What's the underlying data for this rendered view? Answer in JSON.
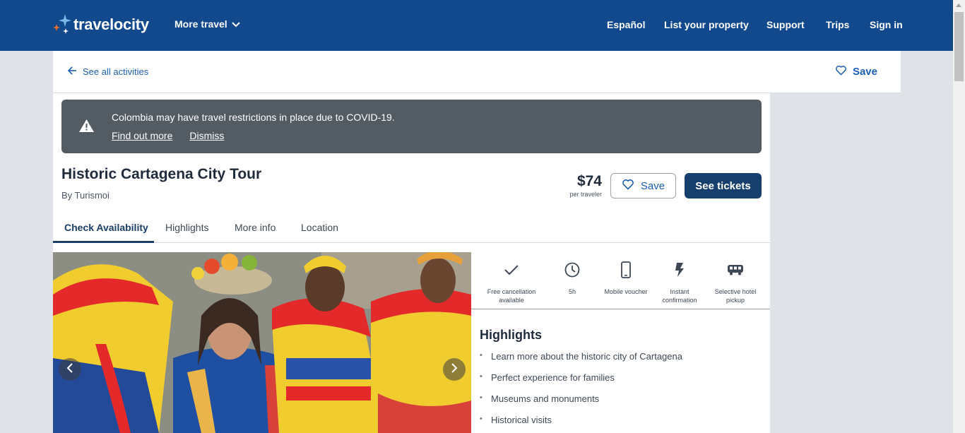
{
  "header": {
    "brand": "travelocity",
    "more_travel": "More travel",
    "nav": [
      "Español",
      "List your property",
      "Support",
      "Trips",
      "Sign in"
    ]
  },
  "subheader": {
    "back_label": "See all activities",
    "save_label": "Save"
  },
  "alert": {
    "message": "Colombia may have travel restrictions in place due to COVID-19.",
    "find_out_more": "Find out more",
    "dismiss": "Dismiss"
  },
  "activity": {
    "title": "Historic Cartagena City Tour",
    "provider": "By Turismoi",
    "price": "$74",
    "price_unit": "per traveler",
    "save_label": "Save",
    "tickets_label": "See tickets"
  },
  "tabs": [
    "Check Availability",
    "Highlights",
    "More info",
    "Location"
  ],
  "features": [
    {
      "icon": "checkmark-icon",
      "label": "Free cancellation available"
    },
    {
      "icon": "clock-icon",
      "label": "5h"
    },
    {
      "icon": "mobile-phone-icon",
      "label": "Mobile voucher"
    },
    {
      "icon": "lightning-bolt-icon",
      "label": "Instant confirmation"
    },
    {
      "icon": "bus-icon",
      "label": "Selective hotel pickup"
    }
  ],
  "highlights": {
    "title": "Highlights",
    "items": [
      "Learn more about the historic city of Cartagena",
      "Perfect experience for families",
      "Museums and monuments",
      "Historical visits"
    ]
  },
  "colors": {
    "header_bg": "#12488c",
    "primary_button": "#173f6e",
    "alert_bg": "#535b63",
    "link": "#1c5fb3"
  }
}
